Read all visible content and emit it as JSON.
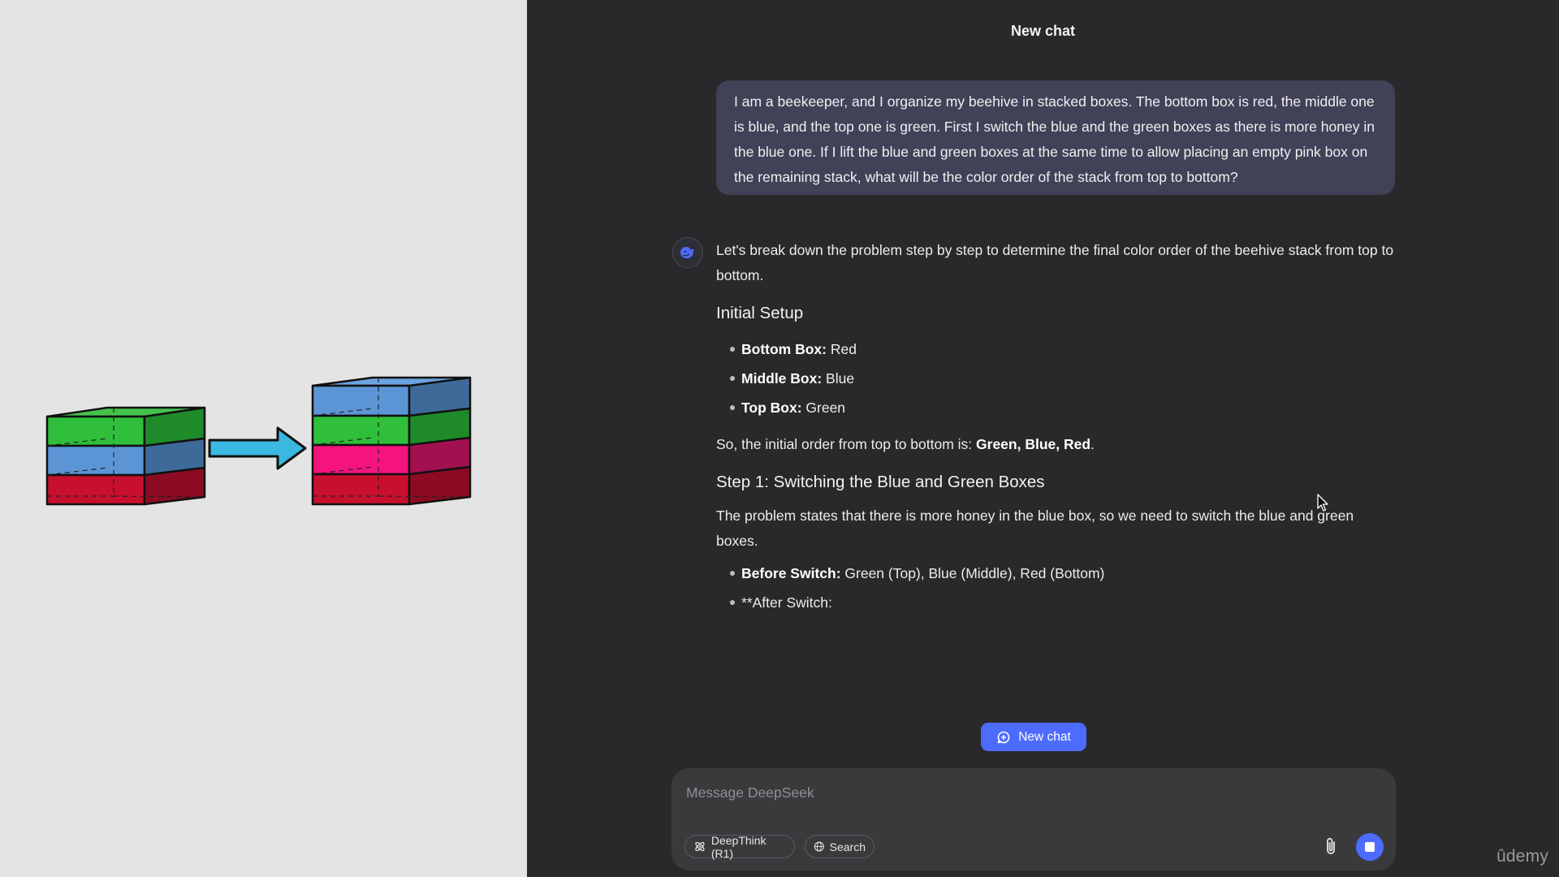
{
  "chat": {
    "title": "New chat",
    "user_message": "I am a beekeeper, and I organize my beehive in stacked boxes. The bottom box is red, the middle one is blue, and the top one is green. First I switch the blue and the green boxes as there is more honey in the blue one. If I lift the blue and green boxes at the same time to allow placing an empty pink box on the remaining stack, what will be the color order of the stack from top to bottom?",
    "assistant": {
      "intro": "Let's break down the problem step by step to determine the final color order of the beehive stack from top to bottom.",
      "section1_heading": "Initial Setup",
      "setup_items": [
        {
          "label": "Bottom Box:",
          "value": " Red"
        },
        {
          "label": "Middle Box:",
          "value": " Blue"
        },
        {
          "label": "Top Box:",
          "value": " Green"
        }
      ],
      "order_text": "So, the initial order from top to bottom is: ",
      "order_bold": "Green, Blue, Red",
      "order_end": ".",
      "section2_heading": "Step 1: Switching the Blue and Green Boxes",
      "step1_text": "The problem states that there is more honey in the blue box, so we need to switch the blue and green boxes.",
      "step1_items": [
        {
          "label": "Before Switch:",
          "value": " Green (Top), Blue (Middle), Red (Bottom)"
        },
        {
          "label": "",
          "value": "**After Switch:"
        }
      ]
    }
  },
  "new_chat_button": {
    "label": "New chat"
  },
  "composer": {
    "placeholder": "Message DeepSeek",
    "deepthink_label": "DeepThink (R1)",
    "search_label": "Search"
  },
  "watermark": "ûdemy",
  "illustration": {
    "left_stack": [
      "green",
      "blue",
      "red"
    ],
    "right_stack": [
      "blue",
      "green",
      "pink",
      "red"
    ]
  },
  "colors": {
    "accent": "#4d6bfe",
    "green": "#2fbf3a",
    "blue": "#5b95d6",
    "red": "#c8102e",
    "pink": "#f5137e",
    "arrow": "#3ab8e0"
  }
}
